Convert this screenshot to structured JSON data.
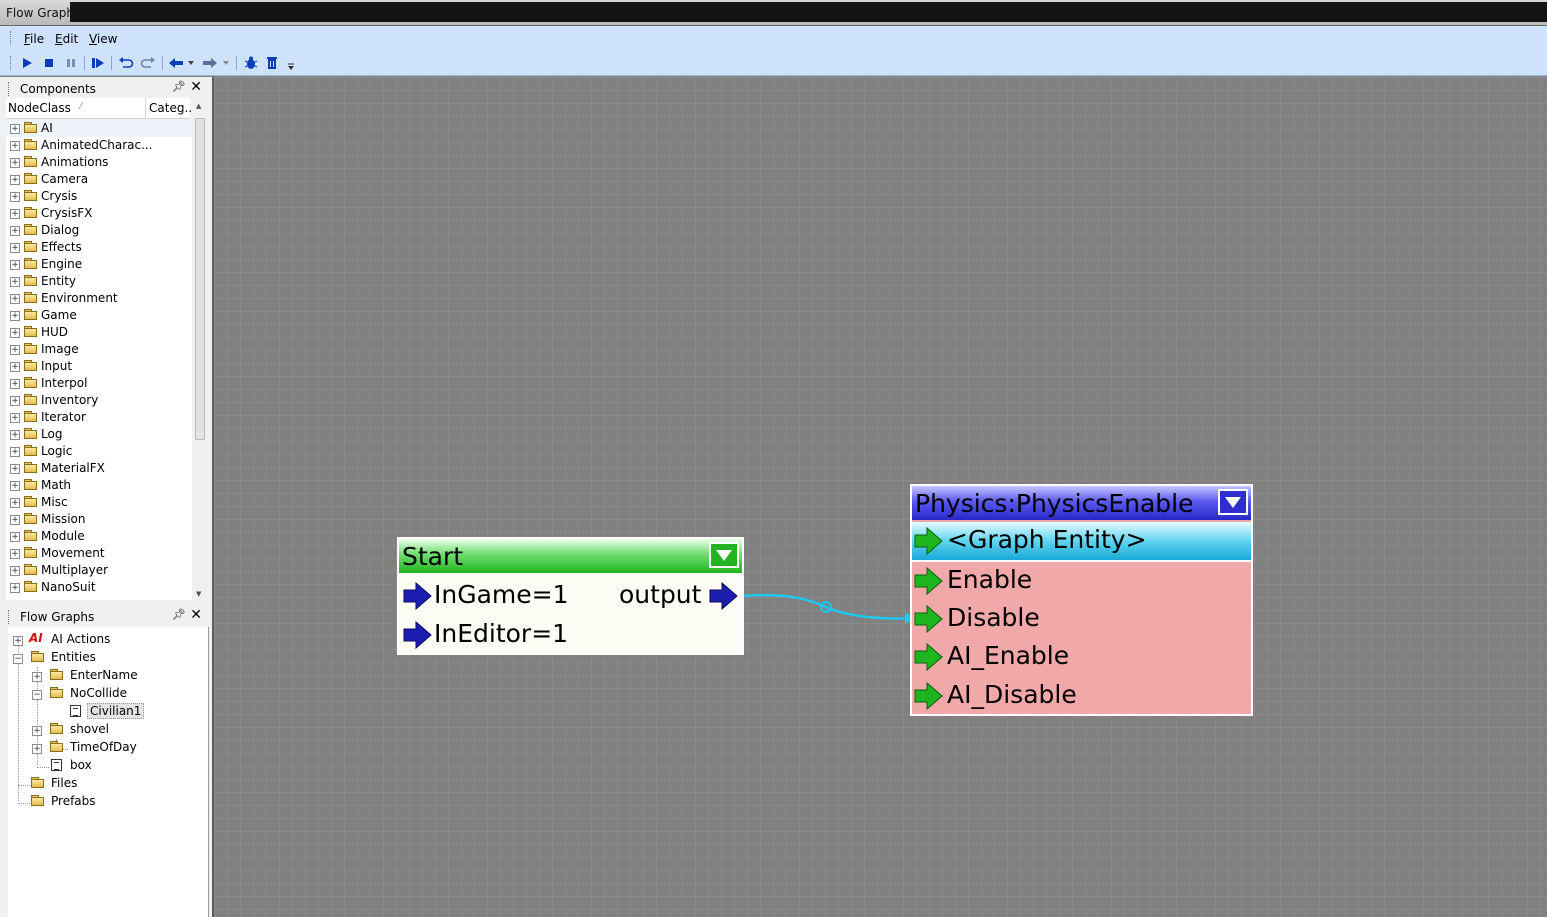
{
  "window": {
    "title": "Flow Graph"
  },
  "menu": [
    {
      "accel": "F",
      "rest": "ile"
    },
    {
      "accel": "E",
      "rest": "dit"
    },
    {
      "accel": "V",
      "rest": "iew"
    }
  ],
  "components": {
    "title": "Components",
    "col_nodeclass": "NodeClass",
    "col_category": "Categ...",
    "items": [
      "AI",
      "AnimatedCharac...",
      "Animations",
      "Camera",
      "Crysis",
      "CrysisFX",
      "Dialog",
      "Effects",
      "Engine",
      "Entity",
      "Environment",
      "Game",
      "HUD",
      "Image",
      "Input",
      "Interpol",
      "Inventory",
      "Iterator",
      "Log",
      "Logic",
      "MaterialFX",
      "Math",
      "Misc",
      "Mission",
      "Module",
      "Movement",
      "Multiplayer",
      "NanoSuit"
    ]
  },
  "flowgraphs": {
    "title": "Flow Graphs",
    "ai_icon": "AI",
    "items": {
      "ai_actions": "AI Actions",
      "entities": "Entities",
      "entername": "EnterName",
      "nocollide": "NoCollide",
      "civilian1": "Civilian1",
      "shovel": "shovel",
      "timeofday": "TimeOfDay",
      "box": "box",
      "files": "Files",
      "prefabs": "Prefabs"
    }
  },
  "nodes": {
    "start": {
      "title": "Start",
      "inputs": [
        "InGame=1",
        "InEditor=1"
      ],
      "output": "output",
      "header_color": "#2fc52f"
    },
    "physics": {
      "title": "Physics:PhysicsEnable",
      "entity": "<Graph Entity>",
      "inputs": [
        "Enable",
        "Disable",
        "AI_Enable",
        "AI_Disable"
      ],
      "header_color": "#3232d8",
      "body_color": "#f0a8a8"
    }
  },
  "colors": {
    "menubar": "#cfe2fc",
    "canvas": "#808080",
    "link": "#1ec8f0",
    "input_arrow": "#1fb51f",
    "start_arrow": "#1d1db0"
  }
}
